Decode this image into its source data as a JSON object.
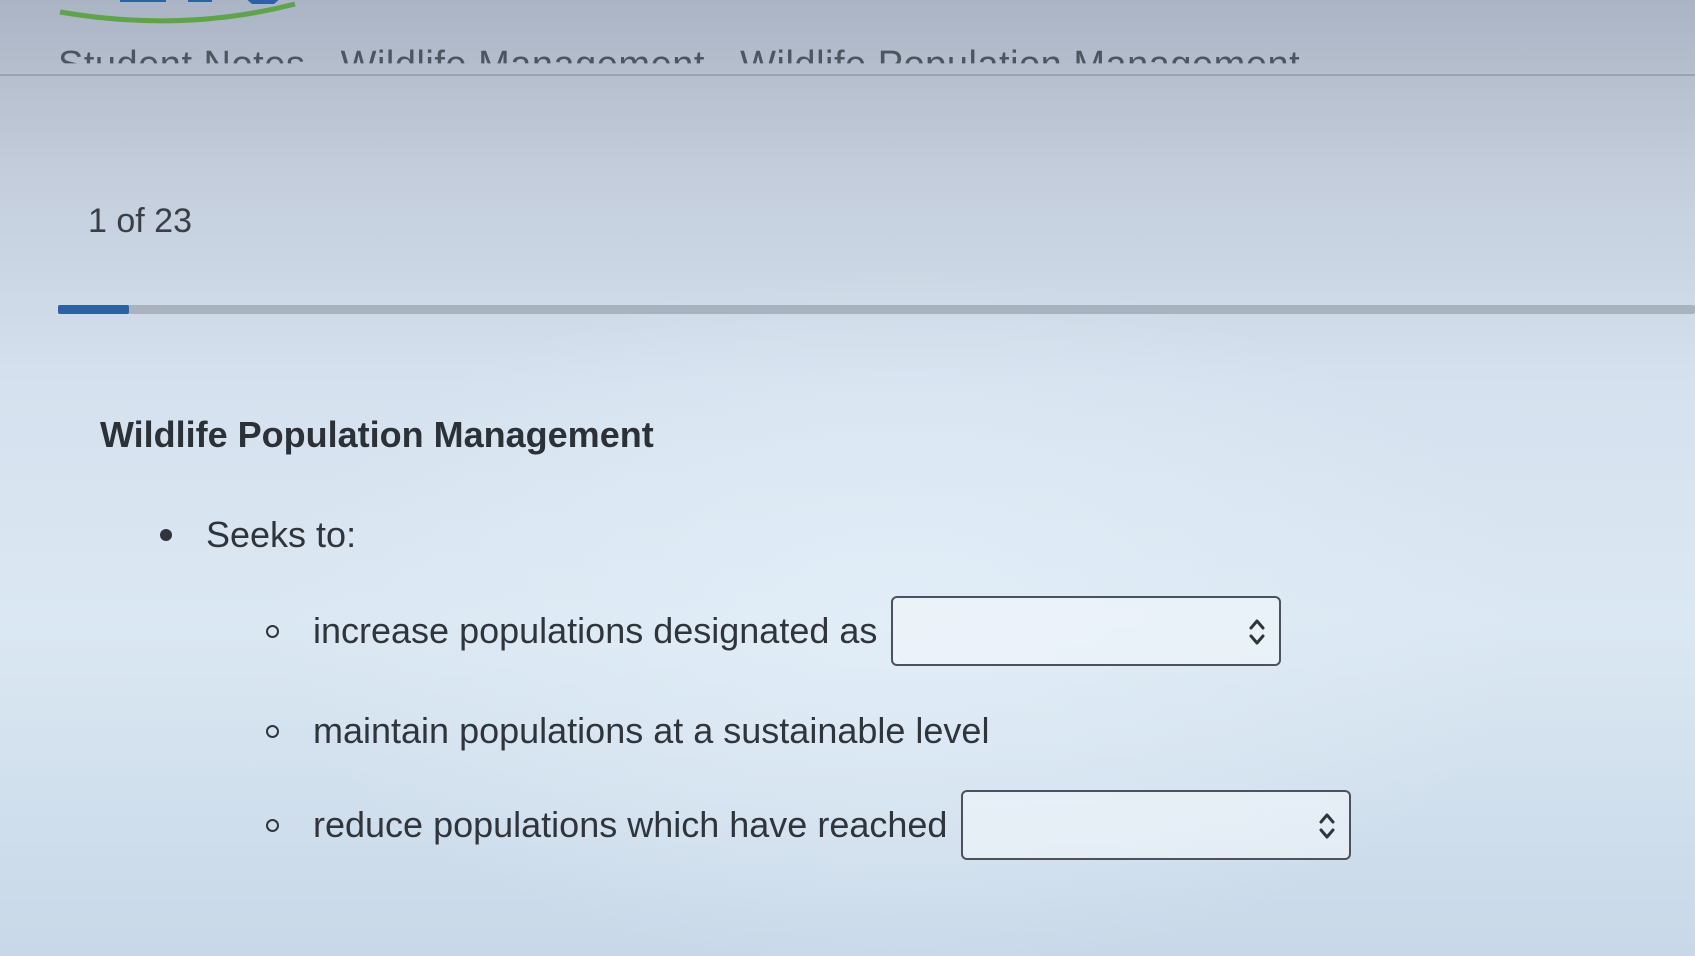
{
  "header": {
    "title": "Student Notes - Wildlife Management - Wildlife Population Management"
  },
  "pagination": {
    "current_label": "1 of 23",
    "progress_fraction": 0.0435
  },
  "colors": {
    "accent": "#2c62a3",
    "text": "#30353c",
    "track": "#a9b3bf"
  },
  "content": {
    "title": "Wildlife Population Management",
    "bullet": "Seeks to:",
    "items": [
      {
        "text": "increase populations designated as",
        "select_value": ""
      },
      {
        "text": "maintain populations at a sustainable level"
      },
      {
        "text": "reduce populations which have reached",
        "select_value": ""
      }
    ]
  },
  "icons": {
    "logo": "logo-icon",
    "select_arrows": "chevron-updown-icon"
  }
}
